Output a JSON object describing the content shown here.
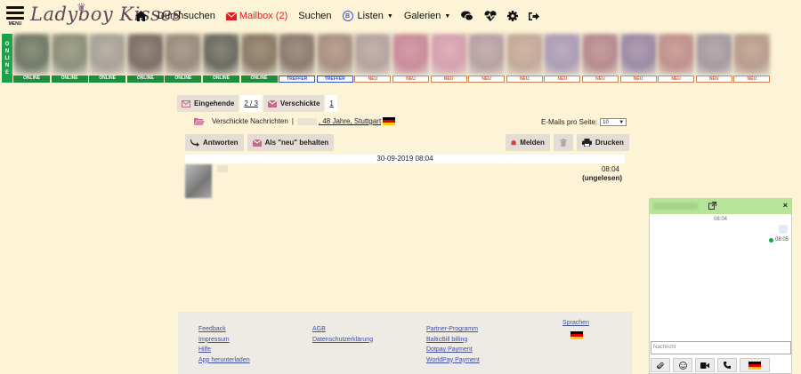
{
  "header": {
    "menu_label": "MENU",
    "logo_text": "Ladyboy Kisses",
    "nav": {
      "browse": "Durchsuchen",
      "mailbox": "Mailbox (2)",
      "search": "Suchen",
      "lists": "Listen",
      "lists_badge": "B",
      "galleries": "Galerien"
    }
  },
  "online_strip": {
    "side_label": "ONLINE",
    "thumbs": [
      {
        "tag": "ONLINE",
        "kind": "online",
        "color": "#6f7a66"
      },
      {
        "tag": "ONLINE",
        "kind": "online",
        "color": "#8c8f7a"
      },
      {
        "tag": "ONLINE",
        "kind": "online",
        "color": "#a8a198"
      },
      {
        "tag": "ONLINE",
        "kind": "online",
        "color": "#7d6e66"
      },
      {
        "tag": "ONLINE",
        "kind": "online",
        "color": "#9a8b7d"
      },
      {
        "tag": "ONLINE",
        "kind": "online",
        "color": "#6b6a62"
      },
      {
        "tag": "ONLINE",
        "kind": "online",
        "color": "#8b7a66"
      },
      {
        "tag": "TREFFER",
        "kind": "treffer",
        "color": "#8c7a6e"
      },
      {
        "tag": "TREFFER",
        "kind": "treffer",
        "color": "#a89080"
      },
      {
        "tag": "NEU",
        "kind": "neu",
        "color": "#b5a2a0"
      },
      {
        "tag": "NEU",
        "kind": "neu",
        "color": "#c98a9a"
      },
      {
        "tag": "NEU",
        "kind": "neu",
        "color": "#d6a0b0"
      },
      {
        "tag": "NEU",
        "kind": "neu",
        "color": "#b8a0a4"
      },
      {
        "tag": "NEU",
        "kind": "neu",
        "color": "#c4a898"
      },
      {
        "tag": "NEU",
        "kind": "neu",
        "color": "#ac9cb6"
      },
      {
        "tag": "NEU",
        "kind": "neu",
        "color": "#b68a90"
      },
      {
        "tag": "NEU",
        "kind": "neu",
        "color": "#9c8aa6"
      },
      {
        "tag": "NEU",
        "kind": "neu",
        "color": "#c0908c"
      },
      {
        "tag": "NEU",
        "kind": "neu",
        "color": "#a59aa0"
      },
      {
        "tag": "NEU",
        "kind": "neu",
        "color": "#b99c8c"
      }
    ]
  },
  "mail": {
    "tabs": {
      "inbox": "Eingehende",
      "inbox_count": "2 / 3",
      "sent": "Verschickte",
      "sent_count": "1"
    },
    "breadcrumb": {
      "folder": "Verschickte Nachrichten",
      "separator": "|",
      "profile": ", 48 Jahre, Stuttgart"
    },
    "per_page_label": "E-Mails pro Seite:",
    "per_page_value": "10",
    "buttons": {
      "reply": "Antworten",
      "keep_new": "Als \"neu\" behalten",
      "report": "Melden",
      "print": "Drucken"
    },
    "message_date": "30-09-2019  08:04",
    "message_time": "08:04",
    "message_status": "(ungelesen)"
  },
  "footer": {
    "col1": [
      "Feedback",
      "Impressum",
      "Hilfe",
      "App herunterladen"
    ],
    "col2": [
      "AGB",
      "Datenschutzerklärung"
    ],
    "col3": [
      "Partner-Programm",
      "BalticBill billing",
      "Dotpay Payment",
      "WorldPay Payment"
    ],
    "languages": "Sprachen"
  },
  "chat": {
    "close": "×",
    "time_header": "08:04",
    "sent_time": "08:05",
    "input_placeholder": "Nachricht"
  }
}
